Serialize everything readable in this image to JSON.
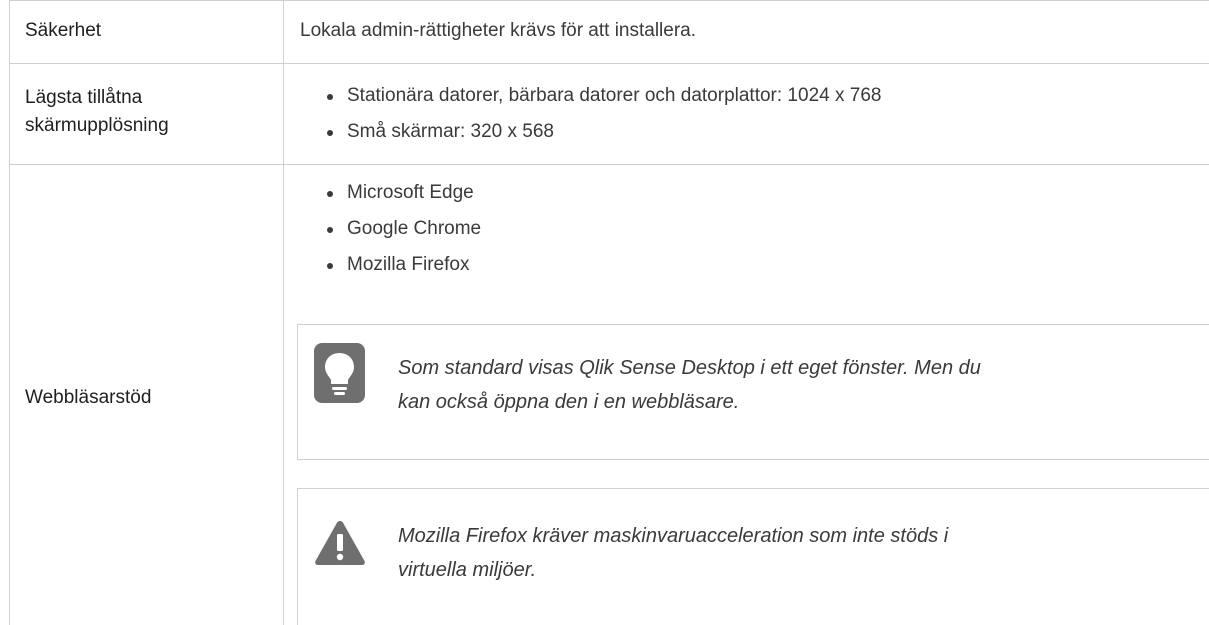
{
  "rows": {
    "security": {
      "label": "Säkerhet",
      "value": "Lokala admin-rättigheter krävs för att installera."
    },
    "resolution": {
      "label_line1": "Lägsta tillåtna",
      "label_line2": "skärmupplösning",
      "items": [
        "Stationära datorer, bärbara datorer och datorplattor: 1024 x 768",
        "Små skärmar: 320 x 568"
      ]
    },
    "browser": {
      "label": "Webbläsarstöd",
      "items": [
        "Microsoft Edge",
        "Google Chrome",
        "Mozilla Firefox"
      ],
      "tip": {
        "icon": "lightbulb-icon",
        "text_line1": "Som standard visas Qlik Sense Desktop i ett eget fönster. Men du",
        "text_line2": "kan också öppna den i en webbläsare."
      },
      "warning": {
        "icon": "warning-icon",
        "text_line1": "Mozilla Firefox kräver maskinvaruacceleration som inte stöds i",
        "text_line2": "virtuella miljöer."
      }
    }
  },
  "colors": {
    "border": "#cfcfcf",
    "icon_gray": "#6f6f6f",
    "text": "#3a3a3a"
  }
}
